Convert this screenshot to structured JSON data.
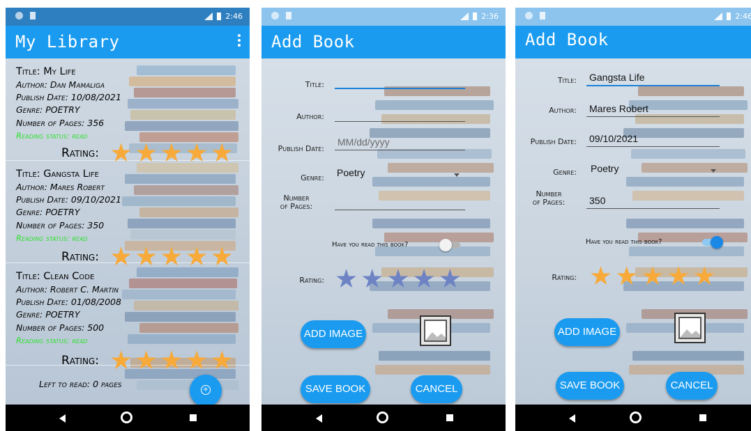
{
  "status_bars": [
    {
      "time": "2:46"
    },
    {
      "time": "2:36"
    },
    {
      "time": "2:46"
    }
  ],
  "library": {
    "title": "My Library",
    "books": [
      {
        "title": "Title: My Life",
        "author": "Author: Dan Mamaliga",
        "publish": "Publish Date: 10/08/2021",
        "genre": "Genre: POETRY",
        "pages": "Number of Pages: 356",
        "status": "Reading status: read",
        "rating_label": "Rating:",
        "rating": 5
      },
      {
        "title": "Title: Gangsta Life",
        "author": "Author: Mares Robert",
        "publish": "Publish Date: 09/10/2021",
        "genre": "Genre: POETRY",
        "pages": "Number of Pages: 350",
        "status": "Reading status: read",
        "rating_label": "Rating:",
        "rating": 5
      },
      {
        "title": "Title: Clean Code",
        "author": "Author: Robert C. Martin",
        "publish": "Publish Date: 01/08/2008",
        "genre": "Genre: POETRY",
        "pages": "Number of Pages: 500",
        "status": "Reading status: read",
        "rating_label": "Rating:",
        "rating": 5
      }
    ],
    "left_to_read": "Left to read: 0 pages"
  },
  "add_book_empty": {
    "title": "Add Book",
    "labels": {
      "title": "Title:",
      "author": "Author:",
      "publish": "Publish Date:",
      "genre": "Genre:",
      "pages_1": "Number",
      "pages_2": "of Pages:",
      "rating": "Rating:"
    },
    "values": {
      "title": "",
      "author": "",
      "publish": "",
      "genre": "Poetry",
      "pages": ""
    },
    "publish_placeholder": "MM/dd/yyyy",
    "question": "Have you read this book?",
    "read_toggle": false,
    "rating": 0,
    "add_image": "ADD IMAGE",
    "save": "SAVE BOOK",
    "cancel": "CANCEL"
  },
  "add_book_filled": {
    "title": "Add Book",
    "labels": {
      "title": "Title:",
      "author": "Author:",
      "publish": "Publish Date:",
      "genre": "Genre:",
      "pages_1": "Number",
      "pages_2": "of Pages:",
      "rating": "Rating:"
    },
    "values": {
      "title": "Gangsta Life",
      "author": "Mares Robert",
      "publish": "09/10/2021",
      "genre": "Poetry",
      "pages": "350"
    },
    "question": "Have you read this book?",
    "read_toggle": true,
    "rating": 5,
    "add_image": "ADD IMAGE",
    "save": "SAVE BOOK",
    "cancel": "CANCEL"
  },
  "colors": {
    "accent": "#1a9bf0",
    "star_filled": "#f7aa3a",
    "star_empty": "#6e83c4",
    "status_read": "#2fe12f"
  },
  "icons": {
    "menu": "overflow-menu-icon",
    "fab": "add-circle-icon",
    "image": "image-placeholder-icon",
    "star": "star-icon",
    "back": "back-triangle-icon",
    "home": "home-circle-icon",
    "recent": "recent-square-icon"
  }
}
